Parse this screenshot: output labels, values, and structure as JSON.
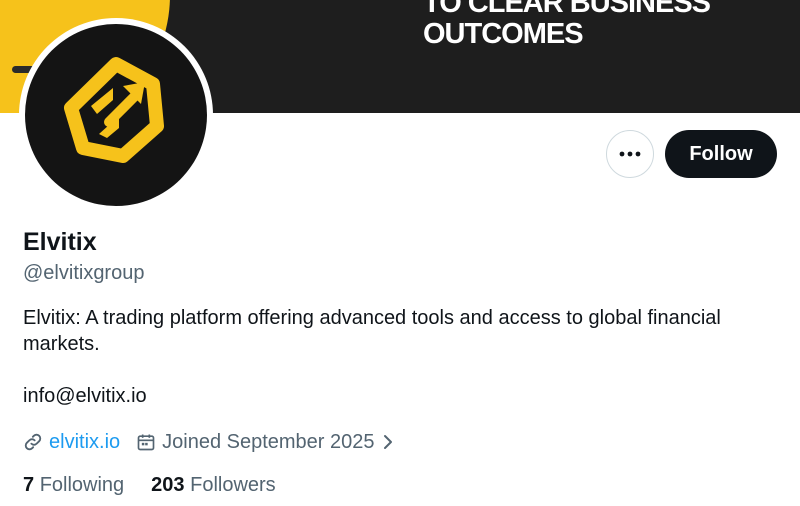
{
  "banner": {
    "line1": "TO CLEAR BUSINESS",
    "line2": "OUTCOMES",
    "colors": {
      "background": "#1e1e1e",
      "accent": "#f6c21b"
    }
  },
  "avatar": {
    "icon": "elvitix-logo-icon",
    "colors": {
      "background": "#141414",
      "logo": "#f6c21b"
    }
  },
  "actions": {
    "more_icon": "more-dots-icon",
    "follow_label": "Follow"
  },
  "profile": {
    "name": "Elvitix",
    "handle": "@elvitixgroup",
    "bio": "Elvitix: A trading platform offering advanced tools and access to global financial markets.",
    "email": "info@elvitix.io",
    "website": "elvitix.io",
    "website_icon": "link-icon",
    "joined": "Joined September 2025",
    "joined_icon": "calendar-icon"
  },
  "stats": {
    "following_count": "7",
    "following_label": "Following",
    "followers_count": "203",
    "followers_label": "Followers"
  },
  "colors": {
    "link": "#1d9bf0",
    "muted": "#536471",
    "text": "#0f1419"
  }
}
